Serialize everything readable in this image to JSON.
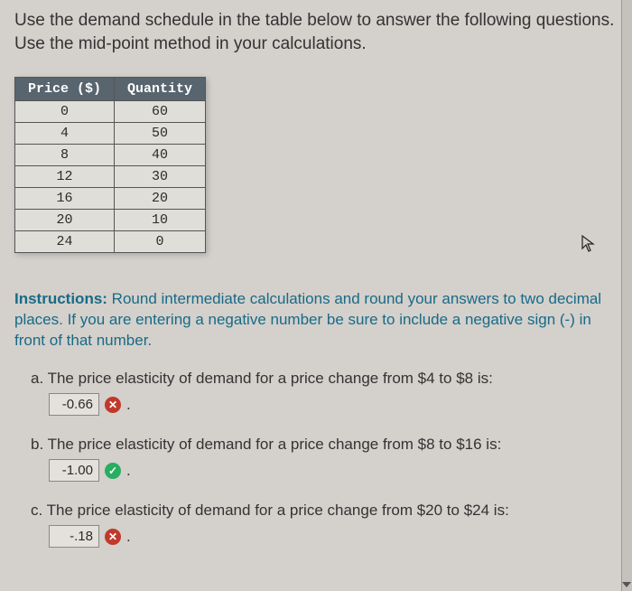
{
  "intro": "Use the demand schedule in the table below to answer the following questions. Use the mid-point method in your calculations.",
  "table": {
    "headers": [
      "Price ($)",
      "Quantity"
    ],
    "rows": [
      [
        "0",
        "60"
      ],
      [
        "4",
        "50"
      ],
      [
        "8",
        "40"
      ],
      [
        "12",
        "30"
      ],
      [
        "16",
        "20"
      ],
      [
        "20",
        "10"
      ],
      [
        "24",
        "0"
      ]
    ]
  },
  "instructions_label": "Instructions:",
  "instructions_text": " Round intermediate calculations and round your answers to two decimal places. If you are entering a negative number be sure to include a negative sign (-) in front of that number.",
  "questions": [
    {
      "label": "a. The price elasticity of demand for a price change from $4 to $8 is:",
      "answer": "-0.66",
      "status": "wrong"
    },
    {
      "label": "b. The price elasticity of demand for a price change from $8 to $16 is:",
      "answer": "-1.00",
      "status": "right"
    },
    {
      "label": "c. The price elasticity of demand for a price change from $20 to $24 is:",
      "answer": "-.18",
      "status": "wrong"
    }
  ],
  "period": ".",
  "icons": {
    "wrong": "✕",
    "right": "✓"
  }
}
